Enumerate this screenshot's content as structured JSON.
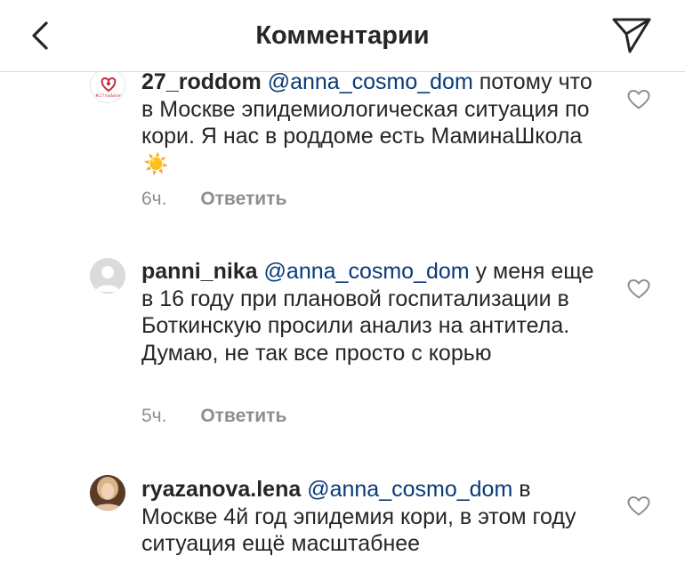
{
  "header": {
    "title": "Комментарии"
  },
  "comments": [
    {
      "username": "27_roddom",
      "mention": "@anna_cosmo_dom",
      "text": " потому что в Москве эпидемиологическая ситуация по кори. Я нас в роддоме есть МаминаШкола",
      "emoji": "☀️",
      "time": "6ч.",
      "reply": "Ответить",
      "avatar_logo": "#27roddom"
    },
    {
      "username": "panni_nika",
      "mention": "@anna_cosmo_dom",
      "text": " у меня еще в 16 году при плановой госпитализации в Боткинскую просили анализ на антитела. Думаю, не так все просто с корью",
      "time": "5ч.",
      "reply": "Ответить"
    },
    {
      "username": "ryazanova.lena",
      "mention": "@anna_cosmo_dom",
      "text": " в Москве 4й год эпидемия кори, в этом году ситуация ещё масштабнее"
    }
  ]
}
